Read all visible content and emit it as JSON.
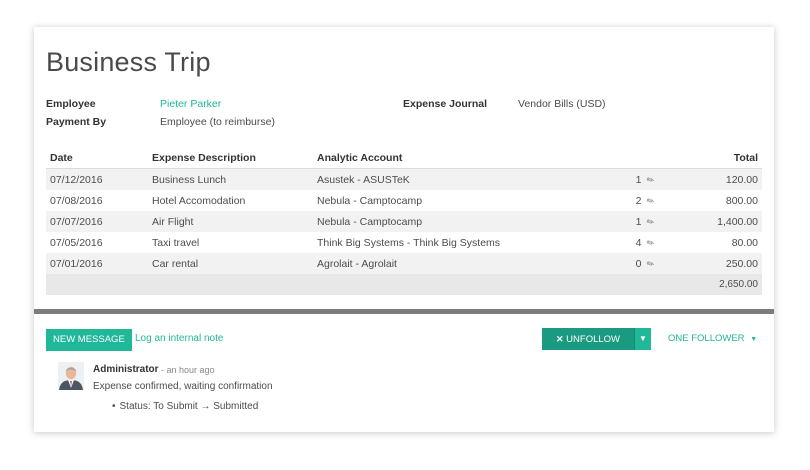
{
  "record": {
    "title": "Business Trip"
  },
  "fields": {
    "employee_label": "Employee",
    "employee_value": "Pieter Parker",
    "payment_by_label": "Payment By",
    "payment_by_value": "Employee (to reimburse)",
    "journal_label": "Expense Journal",
    "journal_value": "Vendor Bills (USD)"
  },
  "lines": {
    "headers": {
      "date": "Date",
      "description": "Expense Description",
      "account": "Analytic Account",
      "total": "Total"
    },
    "rows": [
      {
        "date": "07/12/2016",
        "description": "Business Lunch",
        "account": "Asustek - ASUSTeK",
        "attachments": "1",
        "total": "120.00"
      },
      {
        "date": "07/08/2016",
        "description": "Hotel Accomodation",
        "account": "Nebula - Camptocamp",
        "attachments": "2",
        "total": "800.00"
      },
      {
        "date": "07/07/2016",
        "description": "Air Flight",
        "account": "Nebula - Camptocamp",
        "attachments": "1",
        "total": "1,400.00"
      },
      {
        "date": "07/05/2016",
        "description": "Taxi travel",
        "account": "Think Big Systems - Think Big Systems",
        "attachments": "4",
        "total": "80.00"
      },
      {
        "date": "07/01/2016",
        "description": "Car rental",
        "account": "Agrolait - Agrolait",
        "attachments": "0",
        "total": "250.00"
      }
    ],
    "grand_total": "2,650.00"
  },
  "chatter": {
    "new_message": "NEW MESSAGE",
    "log_note": "Log an internal note",
    "unfollow": "UNFOLLOW",
    "unfollow_icon": "x-icon",
    "follower": "ONE FOLLOWER",
    "message": {
      "author": "Administrator",
      "time": "- an hour ago",
      "body": "Expense confirmed, waiting confirmation",
      "tracking": "Status: To Submit → Submitted"
    }
  },
  "colors": {
    "accent": "#21b799",
    "unfollow": "#1a9a80",
    "divider": "#7c7c7c"
  }
}
